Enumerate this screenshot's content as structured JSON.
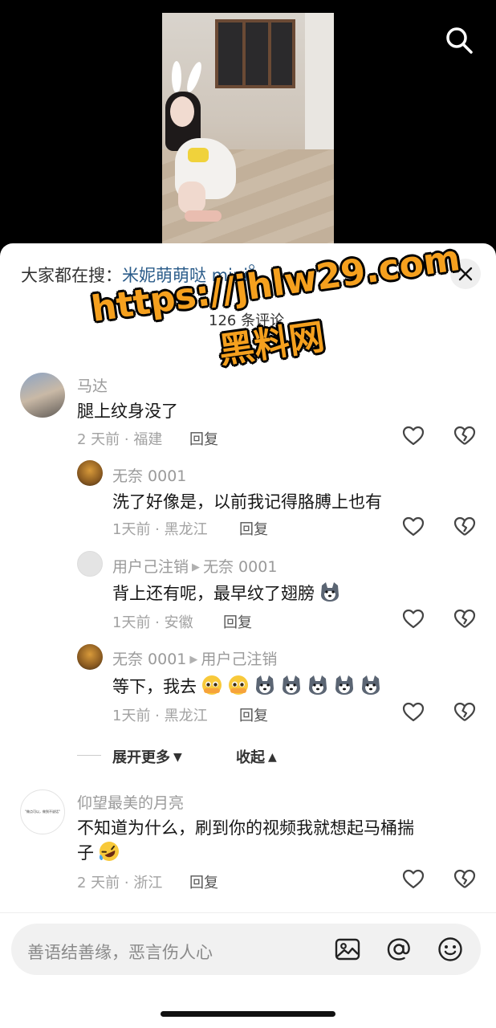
{
  "sheet": {
    "hot_search_prefix": "大家都在搜：",
    "hot_search_keyword": "米妮萌萌哒 mini",
    "comment_count": "126 条评论"
  },
  "watermark": {
    "url": "https://jhlw29.com",
    "name": "黑料网"
  },
  "comments": [
    {
      "user": "马达",
      "text": "腿上纹身没了",
      "time_loc": "2 天前 · 福建",
      "reply_label": "回复"
    },
    {
      "user": "无奈 0001",
      "text": "洗了好像是，以前我记得胳膊上也有",
      "time_loc": "1天前 · 黑龙江",
      "reply_label": "回复"
    },
    {
      "user": "用户己注销",
      "reply_to": "无奈 0001",
      "text": "背上还有呢，最早纹了翅膀",
      "time_loc": "1天前 · 安徽",
      "reply_label": "回复"
    },
    {
      "user": "无奈 0001",
      "reply_to": "用户己注销",
      "text": "等下，我去",
      "time_loc": "1天前 · 黑龙江",
      "reply_label": "回复"
    },
    {
      "user": "仰望最美的月亮",
      "text_line1": "不知道为什么，刷到你的视频我就想起马桶揣",
      "text_line2": "子",
      "time_loc": "2 天前 · 浙江",
      "reply_label": "回复",
      "avatar_text": "\"做点可以，做到不说话\""
    }
  ],
  "thread": {
    "expand_label": "展开更多",
    "collapse_label": "收起"
  },
  "input": {
    "placeholder": "善语结善缘，恶言伤人心"
  },
  "icons": [
    "search-icon",
    "close-icon",
    "heart-icon",
    "dislike-icon",
    "image-icon",
    "at-icon",
    "emoji-icon"
  ],
  "colors": {
    "keyword_link": "#2b5c8a",
    "watermark": "#f5a01e"
  }
}
